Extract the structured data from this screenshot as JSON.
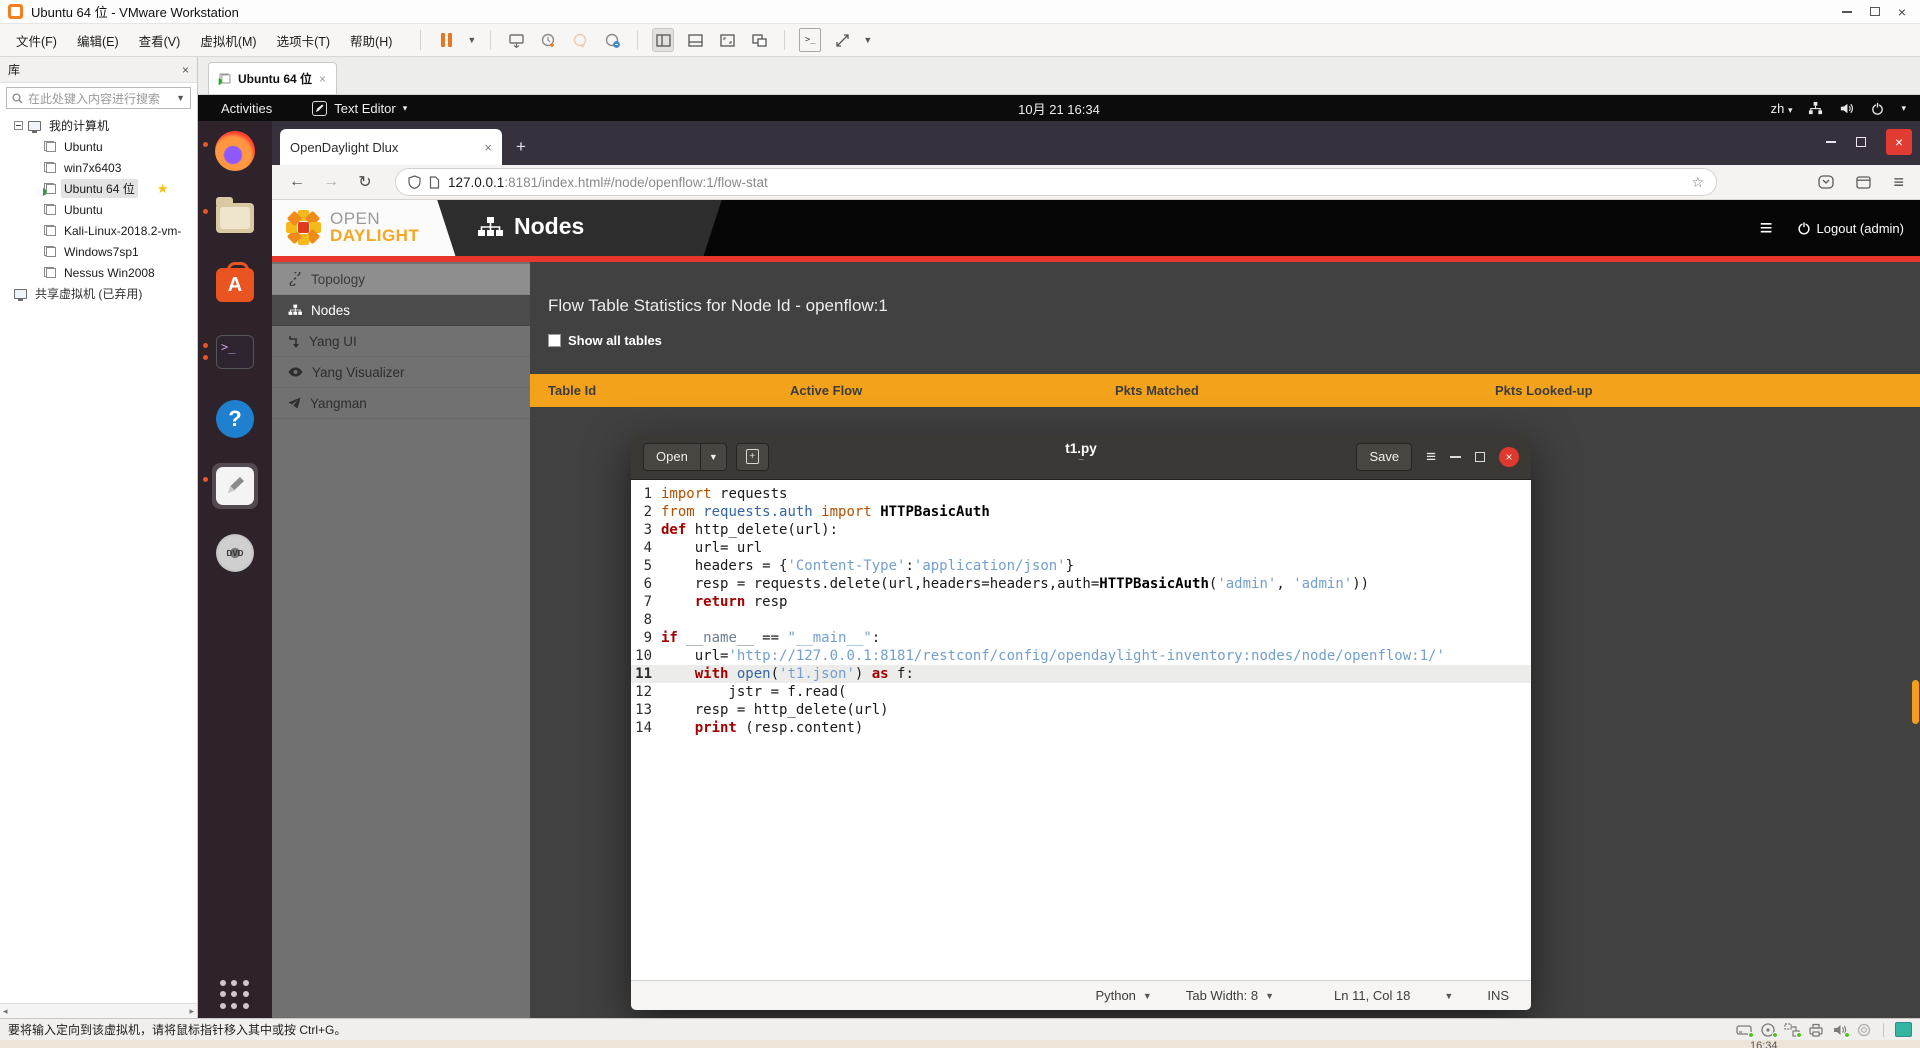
{
  "vmware": {
    "title": "Ubuntu 64 位 - VMware Workstation",
    "menus": [
      "文件(F)",
      "编辑(E)",
      "查看(V)",
      "虚拟机(M)",
      "选项卡(T)",
      "帮助(H)"
    ],
    "library": {
      "header": "库",
      "search_placeholder": "在此处键入内容进行搜索",
      "tree_root": "我的计算机",
      "items": [
        {
          "label": "Ubuntu"
        },
        {
          "label": "win7x6403"
        },
        {
          "label": "Ubuntu 64 位",
          "running": true,
          "selected": true,
          "starred": true
        },
        {
          "label": "Ubuntu"
        },
        {
          "label": "Kali-Linux-2018.2-vm-"
        },
        {
          "label": "Windows7sp1"
        },
        {
          "label": "Nessus Win2008"
        }
      ],
      "shared": "共享虚拟机 (已弃用)"
    },
    "tab": "Ubuntu 64 位",
    "statusbar": {
      "message": "要将输入定向到该虚拟机，请将鼠标指针移入其中或按 Ctrl+G。",
      "tray_icons": [
        {
          "name": "hard-disk-icon",
          "dot": true
        },
        {
          "name": "cd-rom-icon",
          "dot": true
        },
        {
          "name": "network-icon",
          "dot": true
        },
        {
          "name": "printer-icon",
          "dot": false
        },
        {
          "name": "sound-icon",
          "dot": true
        },
        {
          "name": "usb-icon",
          "dot": false
        }
      ]
    },
    "host_clock": "16:34"
  },
  "ubuntu": {
    "topbar": {
      "activities": "Activities",
      "app_name": "Text Editor",
      "clock": "10月 21 16:34",
      "input_method": "zh"
    },
    "dock": [
      {
        "name": "firefox",
        "indicator": 1
      },
      {
        "name": "files",
        "indicator": 1
      },
      {
        "name": "ubuntu-software",
        "indicator": 0
      },
      {
        "name": "terminal",
        "indicator": 2
      },
      {
        "name": "help",
        "indicator": 0
      },
      {
        "name": "text-editor",
        "indicator": 1,
        "active": true
      },
      {
        "name": "dvd",
        "indicator": 0
      },
      {
        "name": "show-apps",
        "indicator": 0,
        "bottom": true
      }
    ]
  },
  "firefox": {
    "tab_title": "OpenDaylight Dlux",
    "url_host": "127.0.0.1",
    "url_rest": ":8181/index.html#/node/openflow:1/flow-stat"
  },
  "opendaylight": {
    "logo_top": "OPEN",
    "logo_bottom": "DAYLIGHT",
    "page_title": "Nodes",
    "logout_label": "Logout (admin)",
    "sidebar": [
      {
        "icon": "link-icon",
        "label": "Topology",
        "state": "hover"
      },
      {
        "icon": "sitemap-icon",
        "label": "Nodes",
        "state": "active"
      },
      {
        "icon": "level-down-icon",
        "label": "Yang UI",
        "state": ""
      },
      {
        "icon": "eye-icon",
        "label": "Yang Visualizer",
        "state": ""
      },
      {
        "icon": "plane-icon",
        "label": "Yangman",
        "state": ""
      }
    ],
    "heading": "Flow Table Statistics for Node Id - openflow:1",
    "show_all_label": "Show all tables",
    "columns": [
      "Table Id",
      "Active Flow",
      "Pkts Matched",
      "Pkts Looked-up"
    ],
    "accent_orange": "#f3a31b",
    "accent_red": "#e8382d"
  },
  "gedit": {
    "open_label": "Open",
    "save_label": "Save",
    "title": "t1.py",
    "path": "~",
    "status": {
      "language": "Python",
      "tab_width": "Tab Width: 8",
      "position": "Ln 11, Col 18",
      "mode": "INS"
    },
    "current_line": 11,
    "code_lines": [
      [
        [
          "kwo",
          "import "
        ],
        [
          "pl",
          "requests"
        ]
      ],
      [
        [
          "kwo",
          "from "
        ],
        [
          "mod",
          "requests.auth"
        ],
        [
          "pl",
          " "
        ],
        [
          "kwo",
          "import "
        ],
        [
          "cls",
          "HTTPBasicAuth"
        ]
      ],
      [
        [
          "kwr",
          "def "
        ],
        [
          "pl",
          "http_delete(url):"
        ]
      ],
      [
        [
          "pl",
          "    url= url"
        ]
      ],
      [
        [
          "pl",
          "    headers = {"
        ],
        [
          "str",
          "'Content-Type'"
        ],
        [
          "pl",
          ":"
        ],
        [
          "str",
          "'application/json'"
        ],
        [
          "pl",
          "}"
        ]
      ],
      [
        [
          "pl",
          "    resp = requests.delete(url,headers=headers,auth="
        ],
        [
          "cls",
          "HTTPBasicAuth"
        ],
        [
          "pl",
          "("
        ],
        [
          "str",
          "'admin'"
        ],
        [
          "pl",
          ", "
        ],
        [
          "str",
          "'admin'"
        ],
        [
          "pl",
          "))"
        ]
      ],
      [
        [
          "pl",
          "    "
        ],
        [
          "kwr",
          "return"
        ],
        [
          "pl",
          " resp"
        ]
      ],
      [],
      [
        [
          "kwr",
          "if "
        ],
        [
          "dund",
          "__name__"
        ],
        [
          "pl",
          " == "
        ],
        [
          "str",
          "\"__main__\""
        ],
        [
          "pl",
          ":"
        ]
      ],
      [
        [
          "pl",
          "    url="
        ],
        [
          "str",
          "'http://127.0.0.1:8181/restconf/config/opendaylight-inventory:nodes/node/openflow:1/'"
        ]
      ],
      [
        [
          "pl",
          "    "
        ],
        [
          "kwr",
          "with "
        ],
        [
          "blt",
          "open"
        ],
        [
          "pl",
          "("
        ],
        [
          "str",
          "'t1.json'"
        ],
        [
          "pl",
          ") "
        ],
        [
          "kwr",
          "as"
        ],
        [
          "pl",
          " f:"
        ]
      ],
      [
        [
          "pl",
          "        jstr = f.read("
        ]
      ],
      [
        [
          "pl",
          "    resp = http_delete(url)"
        ]
      ],
      [
        [
          "pl",
          "    "
        ],
        [
          "kwr",
          "print"
        ],
        [
          "pl",
          " (resp.content)"
        ]
      ]
    ]
  }
}
